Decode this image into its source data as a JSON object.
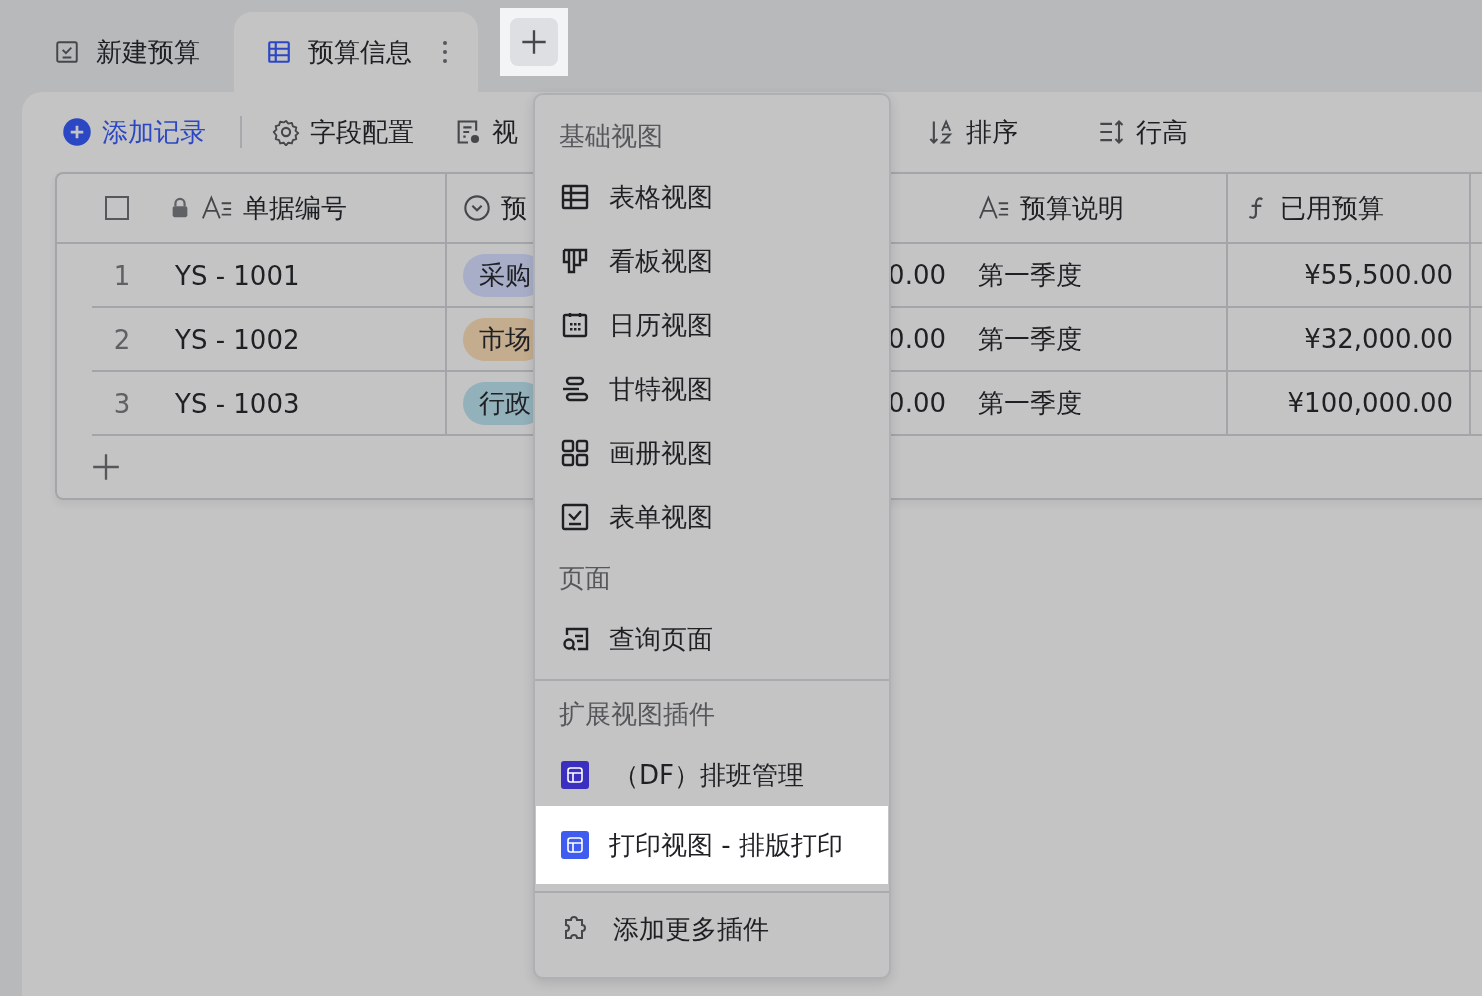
{
  "tabs": [
    {
      "label": "新建预算",
      "selected": false
    },
    {
      "label": "预算信息",
      "selected": true
    }
  ],
  "add_view_button": {
    "highlighted": true
  },
  "toolbar": {
    "add_record": "添加记录",
    "items": [
      "字段配置",
      "视"
    ],
    "right_items": [
      "排序",
      "行高"
    ]
  },
  "table": {
    "select_all_checked": false,
    "columns": [
      "单据编号",
      "预",
      "预算说明",
      "已用预算"
    ],
    "rows": [
      {
        "number": "1",
        "code": "YS - 1001",
        "type": {
          "text": "采购",
          "color": "#a9aec8"
        },
        "amount": "0.00",
        "description": "第一季度",
        "used": "¥55,500.00"
      },
      {
        "number": "2",
        "code": "YS - 1002",
        "type": {
          "text": "市场",
          "color": "#c4ac8e"
        },
        "amount": "0.00",
        "description": "第一季度",
        "used": "¥32,000.00"
      },
      {
        "number": "3",
        "code": "YS - 1003",
        "type": {
          "text": "行政",
          "color": "#93b1bb"
        },
        "amount": "0.00",
        "description": "第一季度",
        "used": "¥100,000.00"
      }
    ]
  },
  "view_menu": {
    "items": [
      {
        "kind": "heading",
        "label": "基础视图"
      },
      {
        "kind": "view",
        "label": "表格视图",
        "highlighted": false
      },
      {
        "kind": "view",
        "label": "看板视图",
        "highlighted": false
      },
      {
        "kind": "view",
        "label": "日历视图",
        "highlighted": false
      },
      {
        "kind": "view",
        "label": "甘特视图",
        "highlighted": false
      },
      {
        "kind": "view",
        "label": "画册视图",
        "highlighted": false
      },
      {
        "kind": "view",
        "label": "表单视图",
        "highlighted": false
      },
      {
        "kind": "heading",
        "label": "页面"
      },
      {
        "kind": "view",
        "label": "查询页面",
        "highlighted": false
      },
      {
        "kind": "divider"
      },
      {
        "kind": "heading",
        "label": "扩展视图插件"
      },
      {
        "kind": "plugin",
        "label": "（DF）排班管理",
        "color": "#3a2fbf",
        "highlighted": false
      },
      {
        "kind": "plugin",
        "label": "打印视图 - 排版打印",
        "color": "#3f5cf0",
        "highlighted": true
      },
      {
        "kind": "divider"
      },
      {
        "kind": "action",
        "label": "添加更多插件",
        "highlighted": false
      }
    ]
  }
}
